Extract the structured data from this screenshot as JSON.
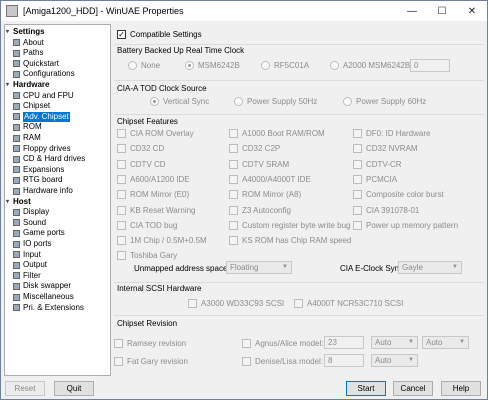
{
  "window": {
    "title": "[Amiga1200_HDD] - WinUAE Properties",
    "minimize": "—",
    "maximize": "☐",
    "close": "✕"
  },
  "tree": {
    "settings": "Settings",
    "items_settings": [
      "About",
      "Paths",
      "Quickstart",
      "Configurations"
    ],
    "hardware": "Hardware",
    "items_hardware": [
      "CPU and FPU",
      "Chipset",
      "Adv. Chipset",
      "ROM",
      "RAM",
      "Floppy drives",
      "CD & Hard drives",
      "Expansions",
      "RTG board",
      "Hardware info"
    ],
    "host": "Host",
    "items_host": [
      "Display",
      "Sound",
      "Game ports",
      "IO ports",
      "Input",
      "Output",
      "Filter",
      "Disk swapper",
      "Miscellaneous",
      "Pri. & Extensions"
    ]
  },
  "compatible": {
    "label": "Compatible Settings",
    "checked": true
  },
  "rtc": {
    "title": "Battery Backed Up Real Time Clock",
    "options": [
      "None",
      "MSM6242B",
      "RF5C01A",
      "A2000 MSM6242B"
    ],
    "selected": "MSM6242B",
    "value": "0"
  },
  "tod": {
    "title": "CIA-A TOD Clock Source",
    "options": [
      "Vertical Sync",
      "Power Supply 50Hz",
      "Power Supply 60Hz"
    ],
    "selected": "Vertical Sync"
  },
  "features": {
    "title": "Chipset Features",
    "col1": [
      "CIA ROM Overlay",
      "CD32 CD",
      "CDTV CD",
      "A600/A1200 IDE",
      "ROM Mirror (E0)",
      "KB Reset Warning",
      "CIA TOD bug",
      "1M Chip / 0.5M+0.5M",
      "Toshiba Gary"
    ],
    "col2": [
      "A1000 Boot RAM/ROM",
      "CD32 C2P",
      "CDTV SRAM",
      "A4000/A4000T IDE",
      "ROM Mirror (A8)",
      "Z3 Autoconfig",
      "Custom register byte write bug",
      "KS ROM has Chip RAM speed"
    ],
    "col3": [
      "DF0: ID Hardware",
      "CD32 NVRAM",
      "CDTV-CR",
      "PCMCIA",
      "Composite color burst",
      "CIA 391078-01",
      "Power up memory pattern"
    ],
    "unmapped_label": "Unmapped address space:",
    "unmapped_value": "Floating",
    "eclock_label": "CIA E-Clock Sync",
    "eclock_value": "Gayle"
  },
  "scsi": {
    "title": "Internal SCSI Hardware",
    "options": [
      "A3000 WD33C93 SCSI",
      "A4000T NCR53C710 SCSI"
    ]
  },
  "revision": {
    "title": "Chipset Revision",
    "ramsey": "Ramsey revision",
    "fatgary": "Fat Gary revision",
    "agnus_label": "Agnus/Alice model:",
    "agnus_value": "23",
    "agnus_sel1": "Auto",
    "agnus_sel2": "Auto",
    "denise_label": "Denise/Lisa model:",
    "denise_value": "8",
    "denise_sel": "Auto"
  },
  "buttons": {
    "reset": "Reset",
    "quit": "Quit",
    "start": "Start",
    "cancel": "Cancel",
    "help": "Help"
  }
}
